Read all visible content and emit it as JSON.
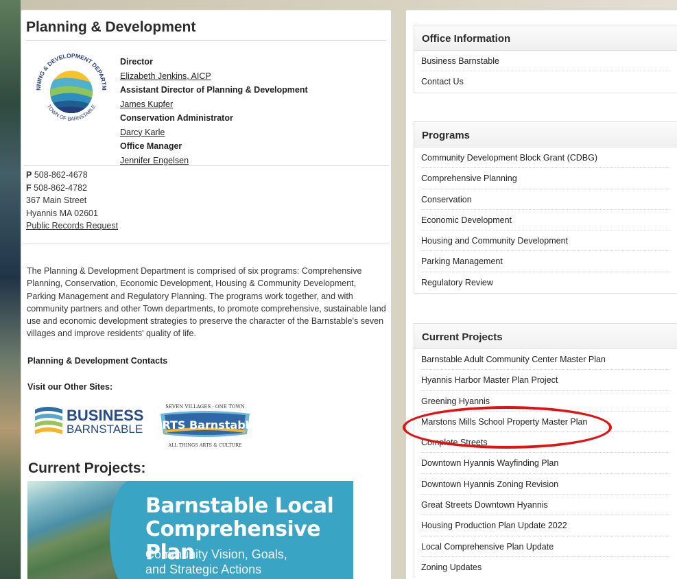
{
  "page_title": "Planning & Development",
  "logo": {
    "top_text": "PLANNING & DEVELOPMENT DEPARTMENT",
    "bottom_text": "TOWN OF BARNSTABLE"
  },
  "staff": [
    {
      "role": "Director",
      "name": "Elizabeth Jenkins, AICP"
    },
    {
      "role": "Assistant Director of Planning & Development",
      "name": "James Kupfer"
    },
    {
      "role": "Conservation Administrator",
      "name": "Darcy Karle"
    },
    {
      "role": "Office Manager",
      "name": "Jennifer Engelsen"
    }
  ],
  "contact": {
    "phone_label": "P",
    "phone": "508-862-4678",
    "fax_label": "F",
    "fax": "508-862-4782",
    "street": "367 Main Street",
    "city": "Hyannis MA 02601",
    "records_link": "Public Records Request"
  },
  "description": "The Planning & Development Department is comprised of six programs: Comprehensive Planning, Conservation, Economic Development, Housing & Community Development, Parking Management and Regulatory Planning. The programs work together, and with community partners and other Town departments, to promote comprehensive, sustainable land use and economic development strategies to preserve the character of the Barnstable's seven villages and improve residents' quality of life.",
  "contacts_link": "Planning & Development Contacts",
  "visit_label": "Visit our Other Sites:",
  "business_logo": {
    "line1": "BUSINESS",
    "line2": "BARNSTABLE"
  },
  "arts_logo": {
    "top": "SEVEN VILLAGES · ONE TOWN",
    "main": "ARTS Barnstable",
    "bottom": "ALL THINGS ARTS & CULTURE"
  },
  "current_projects_heading": "Current Projects:",
  "banner": {
    "title_line1": "Barnstable Local",
    "title_line2": "Comprehensive Plan",
    "sub_line1": "Community Vision, Goals,",
    "sub_line2": "and Strategic Actions"
  },
  "sidebar": {
    "office_info": {
      "title": "Office Information",
      "items": [
        "Business Barnstable",
        "Contact Us"
      ]
    },
    "programs": {
      "title": "Programs",
      "items": [
        "Community Development Block Grant (CDBG)",
        "Comprehensive Planning",
        "Conservation",
        "Economic Development",
        "Housing and Community Development",
        "Parking Management",
        "Regulatory Review"
      ]
    },
    "current_projects": {
      "title": "Current Projects",
      "items": [
        "Barnstable Adult Community Center Master Plan",
        "Hyannis Harbor Master Plan Project",
        "Greening Hyannis",
        "Marstons Mills School Property Master Plan",
        "Complete Streets",
        "Downtown Hyannis Wayfinding Plan",
        "Downtown Hyannis Zoning Revision",
        "Great Streets Downtown Hyannis",
        "Housing Production Plan Update 2022",
        "Local Comprehensive Plan Update",
        "Zoning Updates"
      ]
    }
  },
  "colors": {
    "annotation": "#e01212",
    "banner_blue": "#3aa4c4"
  }
}
